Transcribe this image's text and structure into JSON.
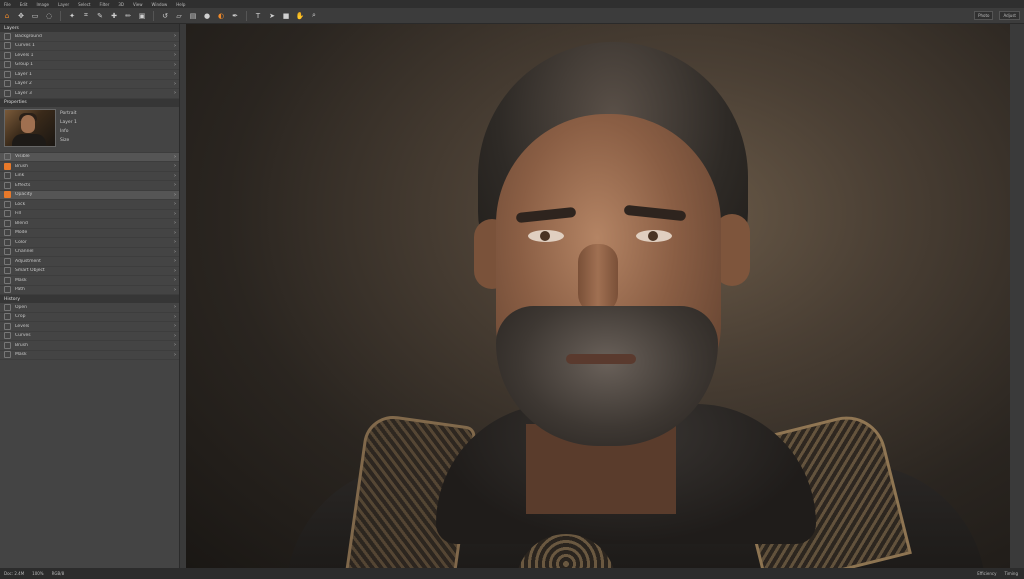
{
  "menubar": [
    "File",
    "Edit",
    "Image",
    "Layer",
    "Select",
    "Filter",
    "3D",
    "View",
    "Window",
    "Help"
  ],
  "toolbar": {
    "tools": [
      "home",
      "move",
      "marquee",
      "lasso",
      "wand",
      "crop",
      "eyedropper",
      "heal",
      "brush",
      "stamp",
      "history",
      "eraser",
      "gradient",
      "blur",
      "dodge",
      "pen",
      "text",
      "path",
      "shape",
      "hand",
      "zoom"
    ],
    "right": [
      "Photo",
      "Adjust"
    ]
  },
  "left_panel": {
    "title": "Layers",
    "rows_top": [
      {
        "icon": "layer-icon",
        "label": "Background"
      },
      {
        "icon": "adjust-icon",
        "label": "Curves 1"
      },
      {
        "icon": "mask-icon",
        "label": "Levels 1"
      },
      {
        "icon": "folder-icon",
        "label": "Group 1"
      },
      {
        "icon": "layer-icon",
        "label": "Layer 1"
      },
      {
        "icon": "layer-icon",
        "label": "Layer 2"
      },
      {
        "icon": "layer-icon",
        "label": "Layer 3"
      }
    ],
    "properties_title": "Properties",
    "preview_meta": [
      "Portrait",
      "Layer 1",
      "Info",
      "Size"
    ],
    "rows_mid": [
      {
        "icon": "eye-icon",
        "label": "Visible",
        "orange": false,
        "selected": true
      },
      {
        "icon": "brush-icon",
        "label": "Brush",
        "orange": true,
        "selected": false
      },
      {
        "icon": "link-icon",
        "label": "Link",
        "orange": false,
        "selected": false
      },
      {
        "icon": "fx-icon",
        "label": "Effects",
        "orange": false,
        "selected": false
      },
      {
        "icon": "dot-icon",
        "label": "Opacity",
        "orange": true,
        "selected": true
      },
      {
        "icon": "lock-icon",
        "label": "Lock",
        "orange": false,
        "selected": false
      },
      {
        "icon": "fill-icon",
        "label": "Fill",
        "orange": false,
        "selected": false
      },
      {
        "icon": "check-icon",
        "label": "Blend",
        "orange": false,
        "selected": false
      },
      {
        "icon": "check-icon",
        "label": "Mode",
        "orange": false,
        "selected": false
      },
      {
        "icon": "layer-icon",
        "label": "Color",
        "orange": false,
        "selected": false
      },
      {
        "icon": "layer-icon",
        "label": "Channel",
        "orange": false,
        "selected": false
      },
      {
        "icon": "layer-icon",
        "label": "Adjustment",
        "orange": false,
        "selected": false
      },
      {
        "icon": "layer-icon",
        "label": "Smart Object",
        "orange": false,
        "selected": false
      },
      {
        "icon": "layer-icon",
        "label": "Mask",
        "orange": false,
        "selected": false
      },
      {
        "icon": "layer-icon",
        "label": "Path",
        "orange": false,
        "selected": false
      }
    ],
    "history_title": "History",
    "rows_bottom": [
      {
        "icon": "history-icon",
        "label": "Open"
      },
      {
        "icon": "history-icon",
        "label": "Crop"
      },
      {
        "icon": "history-icon",
        "label": "Levels"
      },
      {
        "icon": "history-icon",
        "label": "Curves"
      },
      {
        "icon": "history-icon",
        "label": "Brush"
      },
      {
        "icon": "history-icon",
        "label": "Mask"
      }
    ]
  },
  "statusbar": {
    "left": [
      "Doc: 2.4M",
      "100%",
      "RGB/8"
    ],
    "right": [
      "Efficiency",
      "Timing"
    ]
  }
}
